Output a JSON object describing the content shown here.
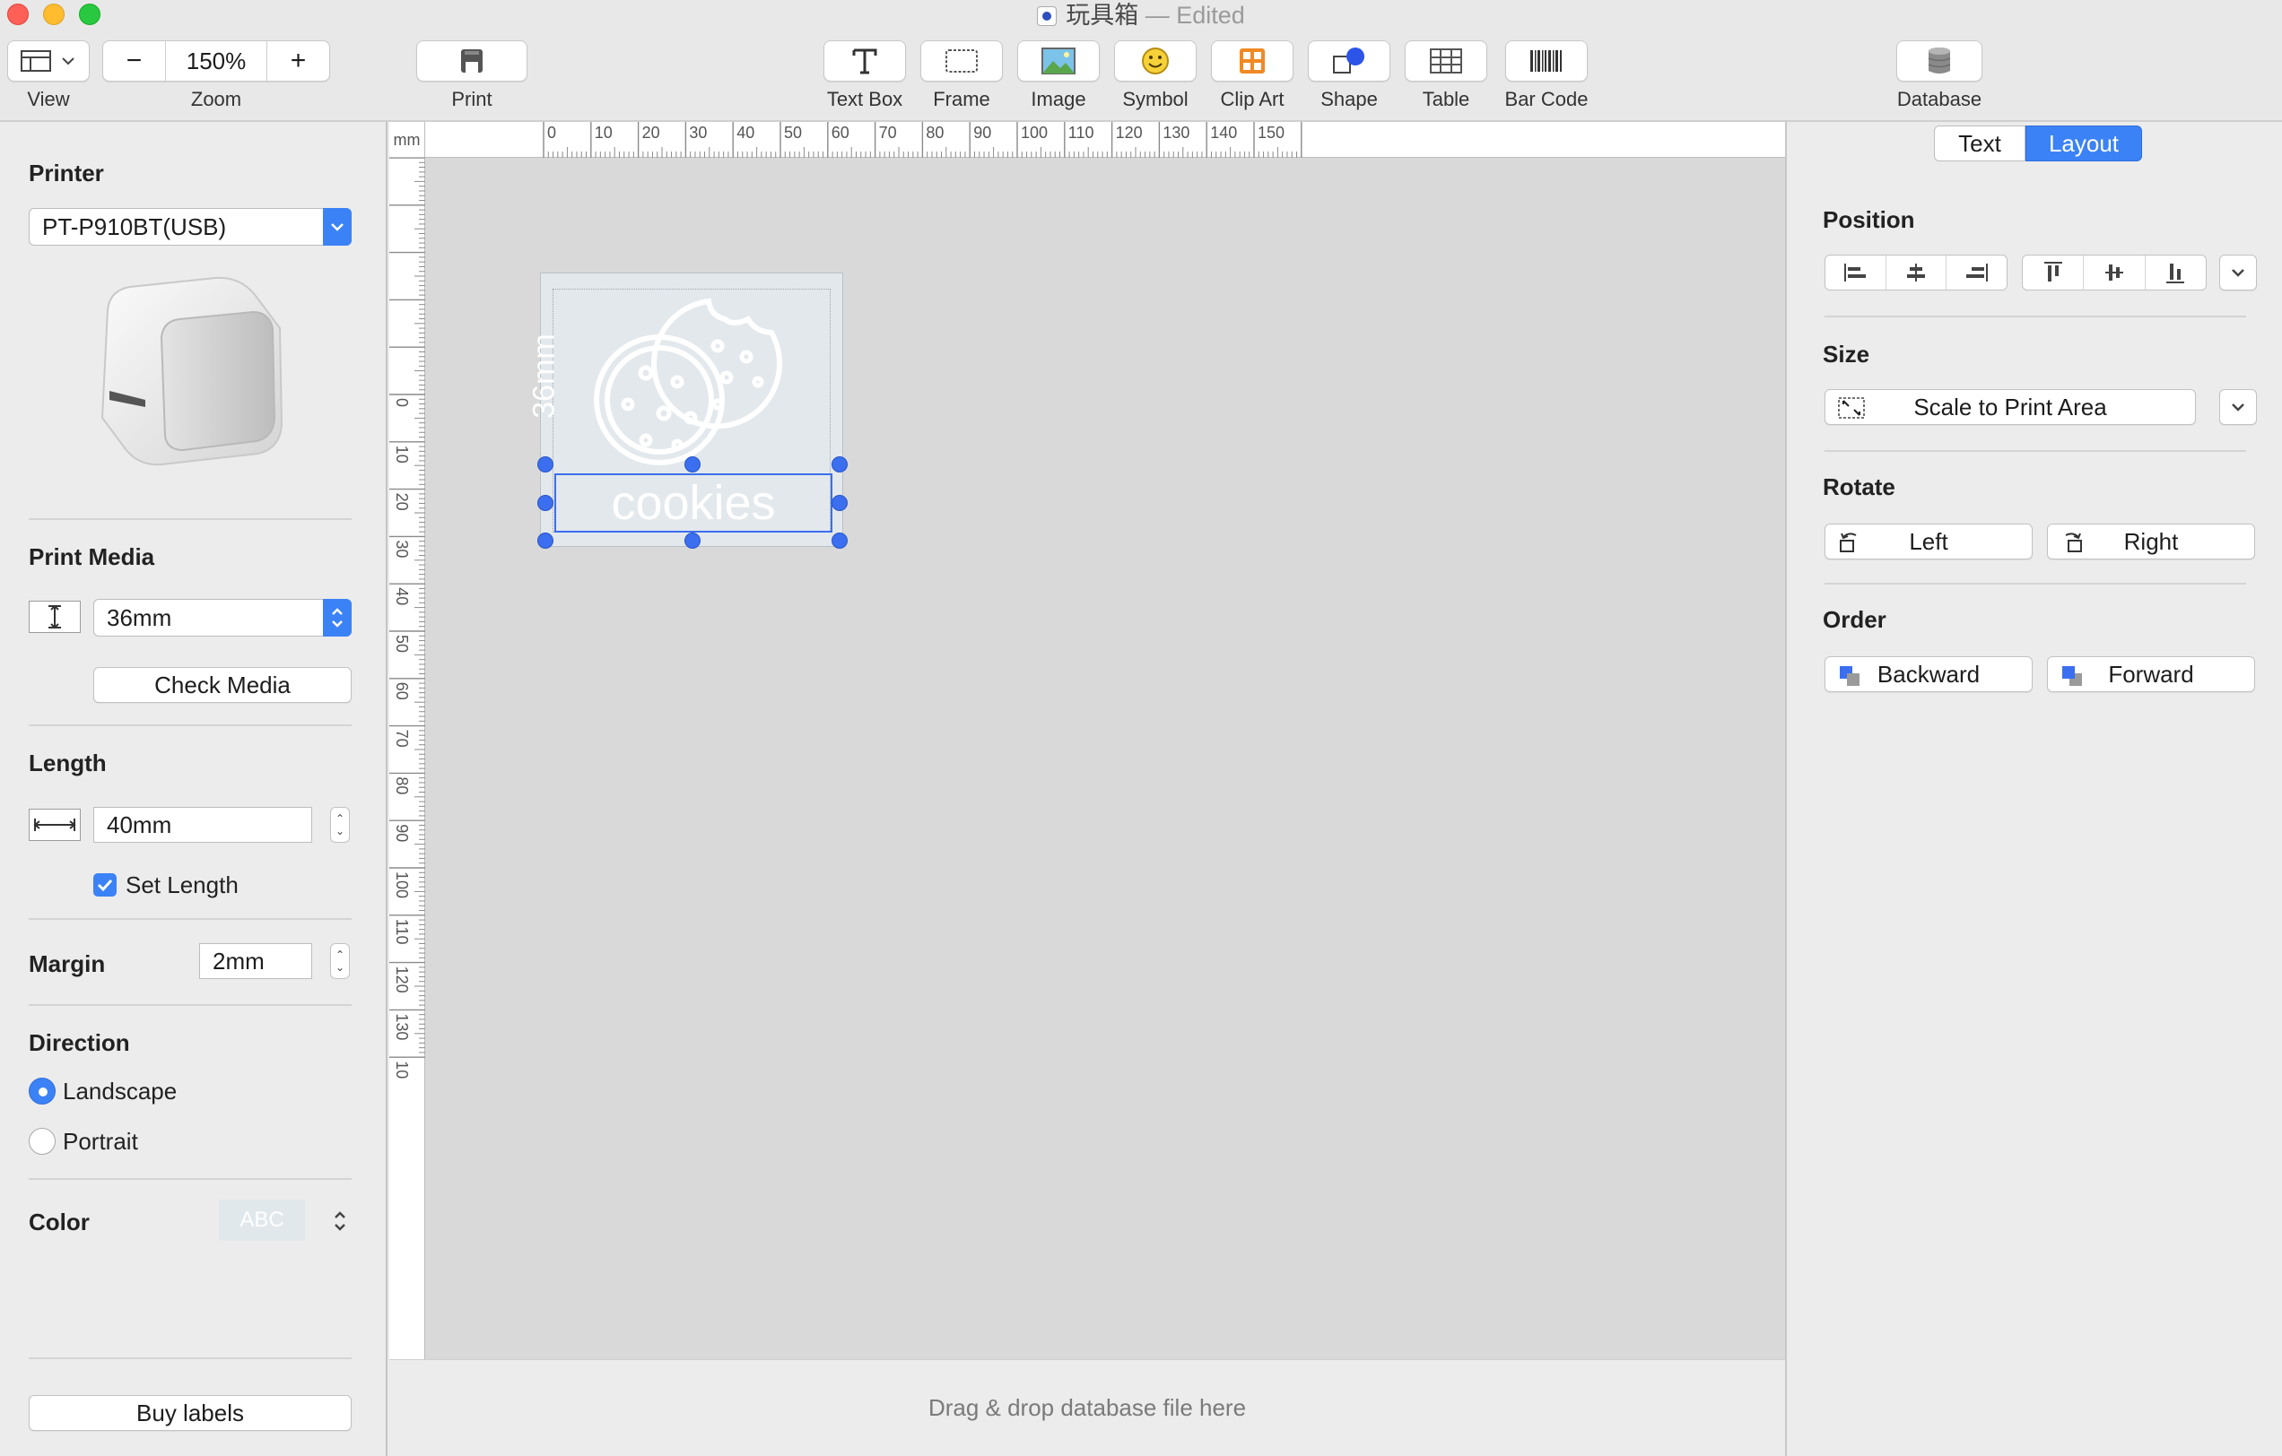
{
  "window": {
    "title": "玩具箱",
    "status": "— Edited"
  },
  "toolbar": {
    "view_label": "View",
    "zoom_label": "Zoom",
    "zoom_value": "150%",
    "zoom_minus": "−",
    "zoom_plus": "+",
    "print_label": "Print",
    "text_box_label": "Text Box",
    "frame_label": "Frame",
    "image_label": "Image",
    "symbol_label": "Symbol",
    "clip_art_label": "Clip Art",
    "shape_label": "Shape",
    "table_label": "Table",
    "bar_code_label": "Bar Code",
    "database_label": "Database"
  },
  "sidebar": {
    "printer_title": "Printer",
    "printer_value": "PT-P910BT(USB)",
    "print_media_title": "Print Media",
    "media_value": "36mm",
    "check_media_label": "Check Media",
    "length_title": "Length",
    "length_value": "40mm",
    "set_length_label": "Set Length",
    "set_length_checked": true,
    "margin_title": "Margin",
    "margin_value": "2mm",
    "direction_title": "Direction",
    "landscape_label": "Landscape",
    "portrait_label": "Portrait",
    "direction_selected": "Landscape",
    "color_title": "Color",
    "color_value": "ABC",
    "buy_labels_label": "Buy labels"
  },
  "canvas": {
    "unit": "mm",
    "ruler_top": [
      "0",
      "10",
      "20",
      "30",
      "40",
      "50",
      "60",
      "70",
      "80",
      "90",
      "100",
      "110",
      "120",
      "130",
      "140",
      "150"
    ],
    "ruler_left": [
      "0",
      "10",
      "20",
      "30",
      "40",
      "50",
      "60",
      "70",
      "80",
      "90",
      "100",
      "110",
      "120",
      "130",
      "10"
    ],
    "tape_dimension": "36mm",
    "label_text": "cookies",
    "drop_hint": "Drag & drop database file here"
  },
  "inspector": {
    "tab_text": "Text",
    "tab_layout": "Layout",
    "active_tab": "Layout",
    "position_title": "Position",
    "size_title": "Size",
    "scale_label": "Scale to Print Area",
    "rotate_title": "Rotate",
    "rotate_left": "Left",
    "rotate_right": "Right",
    "order_title": "Order",
    "backward_label": "Backward",
    "forward_label": "Forward"
  },
  "colors": {
    "accent": "#3b82f6",
    "selection": "#3b6ff0",
    "label_bg": "#e3e8ec"
  }
}
